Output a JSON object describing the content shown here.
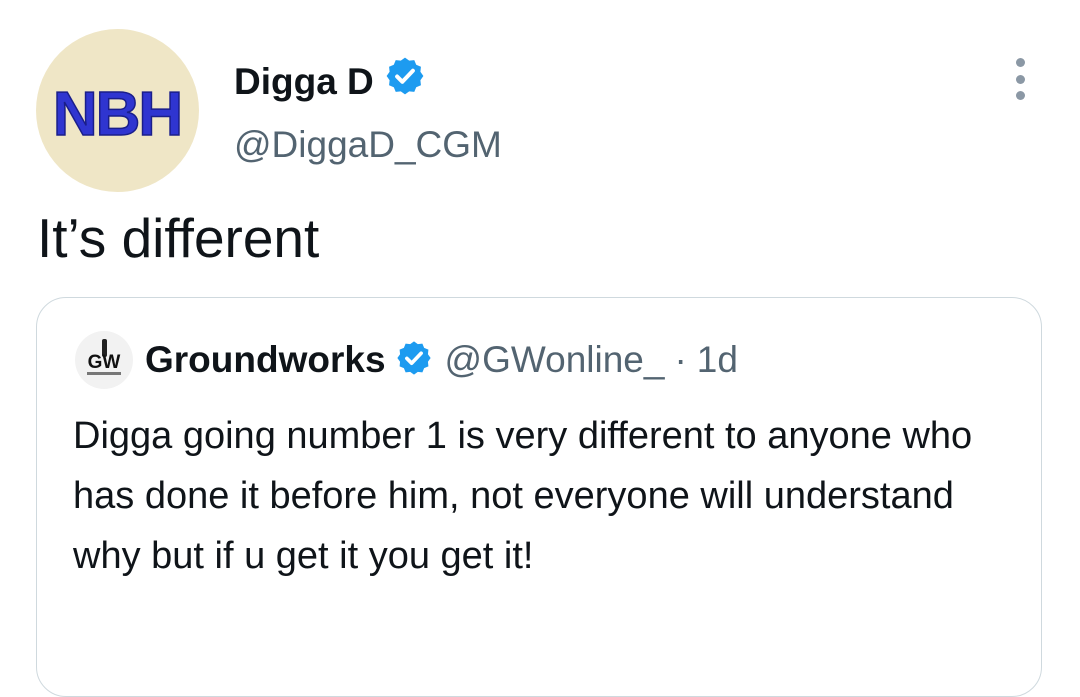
{
  "tweet": {
    "author": {
      "display_name": "Digga D",
      "handle": "@DiggaD_CGM",
      "avatar_text": "NBH",
      "verified_icon": "verified-badge-icon"
    },
    "text": "It’s different",
    "more_icon": "more-options-icon"
  },
  "quoted_tweet": {
    "author": {
      "display_name": "Groundworks",
      "handle": "@GWonline_",
      "avatar_text": "GW",
      "verified_icon": "verified-badge-icon"
    },
    "separator": "·",
    "time": "1d",
    "text": "Digga going number 1 is very different to anyone who has done it before him, not everyone will understand why but if u get it you get it!"
  },
  "colors": {
    "verified": "#1d9bf0",
    "secondary_text": "#536471",
    "border": "#cfd9de",
    "avatar_bg": "#efe6c6",
    "logo_blue": "#2f35d0"
  }
}
